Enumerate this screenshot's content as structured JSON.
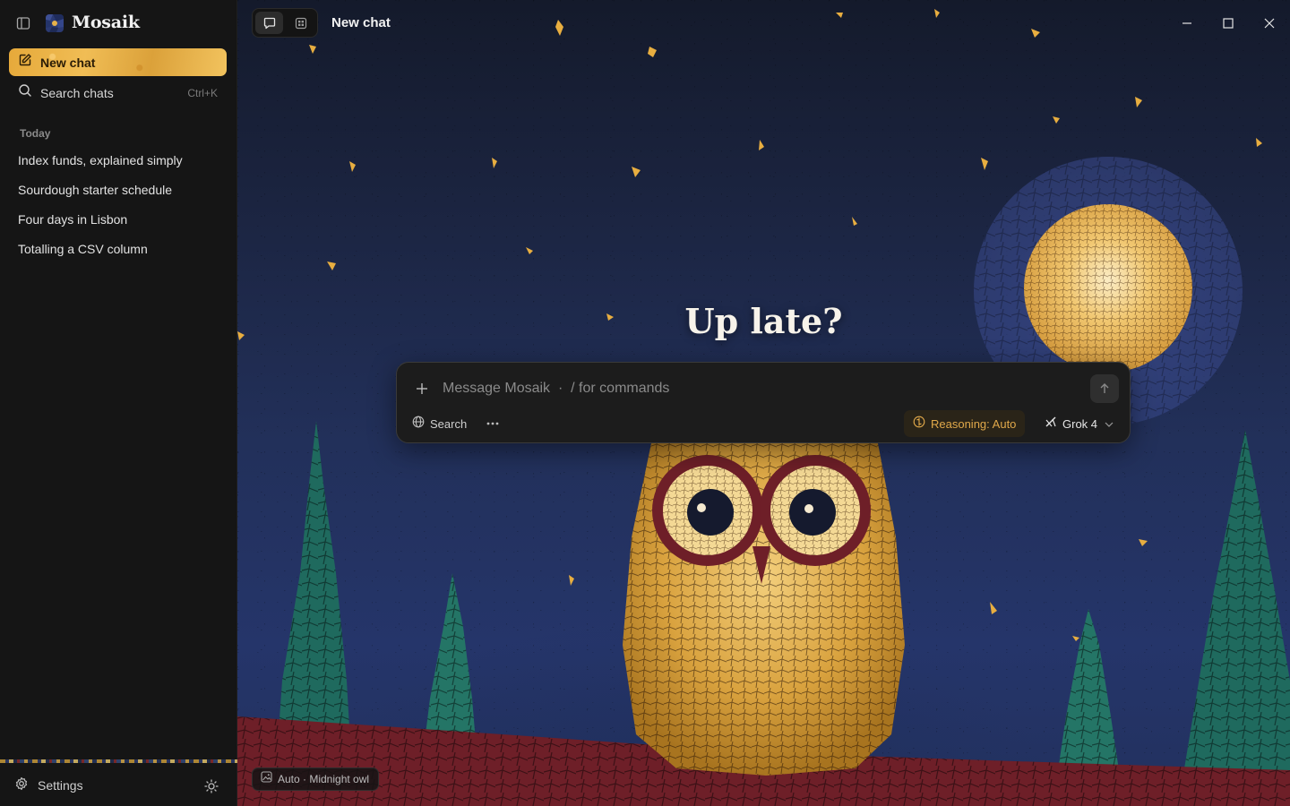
{
  "app": {
    "name": "Mosaik"
  },
  "sidebar": {
    "new_chat_label": "New chat",
    "search_label": "Search chats",
    "search_shortcut": "Ctrl+K",
    "section_today": "Today",
    "history": [
      {
        "label": "Index funds, explained simply"
      },
      {
        "label": "Sourdough starter schedule"
      },
      {
        "label": "Four days in Lisbon"
      },
      {
        "label": "Totalling a CSV column"
      }
    ],
    "settings_label": "Settings"
  },
  "header": {
    "chat_title": "New chat",
    "modes": [
      "chat-icon",
      "grid-icon"
    ],
    "active_mode": "chat"
  },
  "main": {
    "greeting": "Up late?",
    "composer": {
      "placeholder": "Message Mosaik  ·  / for commands",
      "value": "",
      "search_label": "Search",
      "reasoning_label": "Reasoning: Auto",
      "model_label": "Grok 4"
    },
    "background_badge": "Auto · Midnight owl"
  },
  "colors": {
    "accent": "#E8AE40",
    "sidebar_bg": "#151515",
    "composer_bg": "#1C1C1C",
    "reasoning_text": "#E0A84A",
    "night_sky": "#22305A",
    "owl_gold": "#D9A23E",
    "owl_eye_ring": "#6E1F28",
    "foliage": "#1E6A5E"
  },
  "icons": {
    "sidebar_toggle": "sidebar-toggle-icon",
    "new_chat": "edit-icon",
    "search": "search-icon",
    "settings": "gear-icon",
    "theme": "sun-icon",
    "plus": "plus-icon",
    "send": "arrow-up-icon",
    "web_search": "globe-icon",
    "more": "ellipsis-icon",
    "reasoning": "brain-icon",
    "model": "grok-icon",
    "chevron": "chevron-down-icon",
    "badge": "image-icon",
    "minimize": "minimize-icon",
    "maximize": "maximize-icon",
    "close": "close-icon"
  }
}
